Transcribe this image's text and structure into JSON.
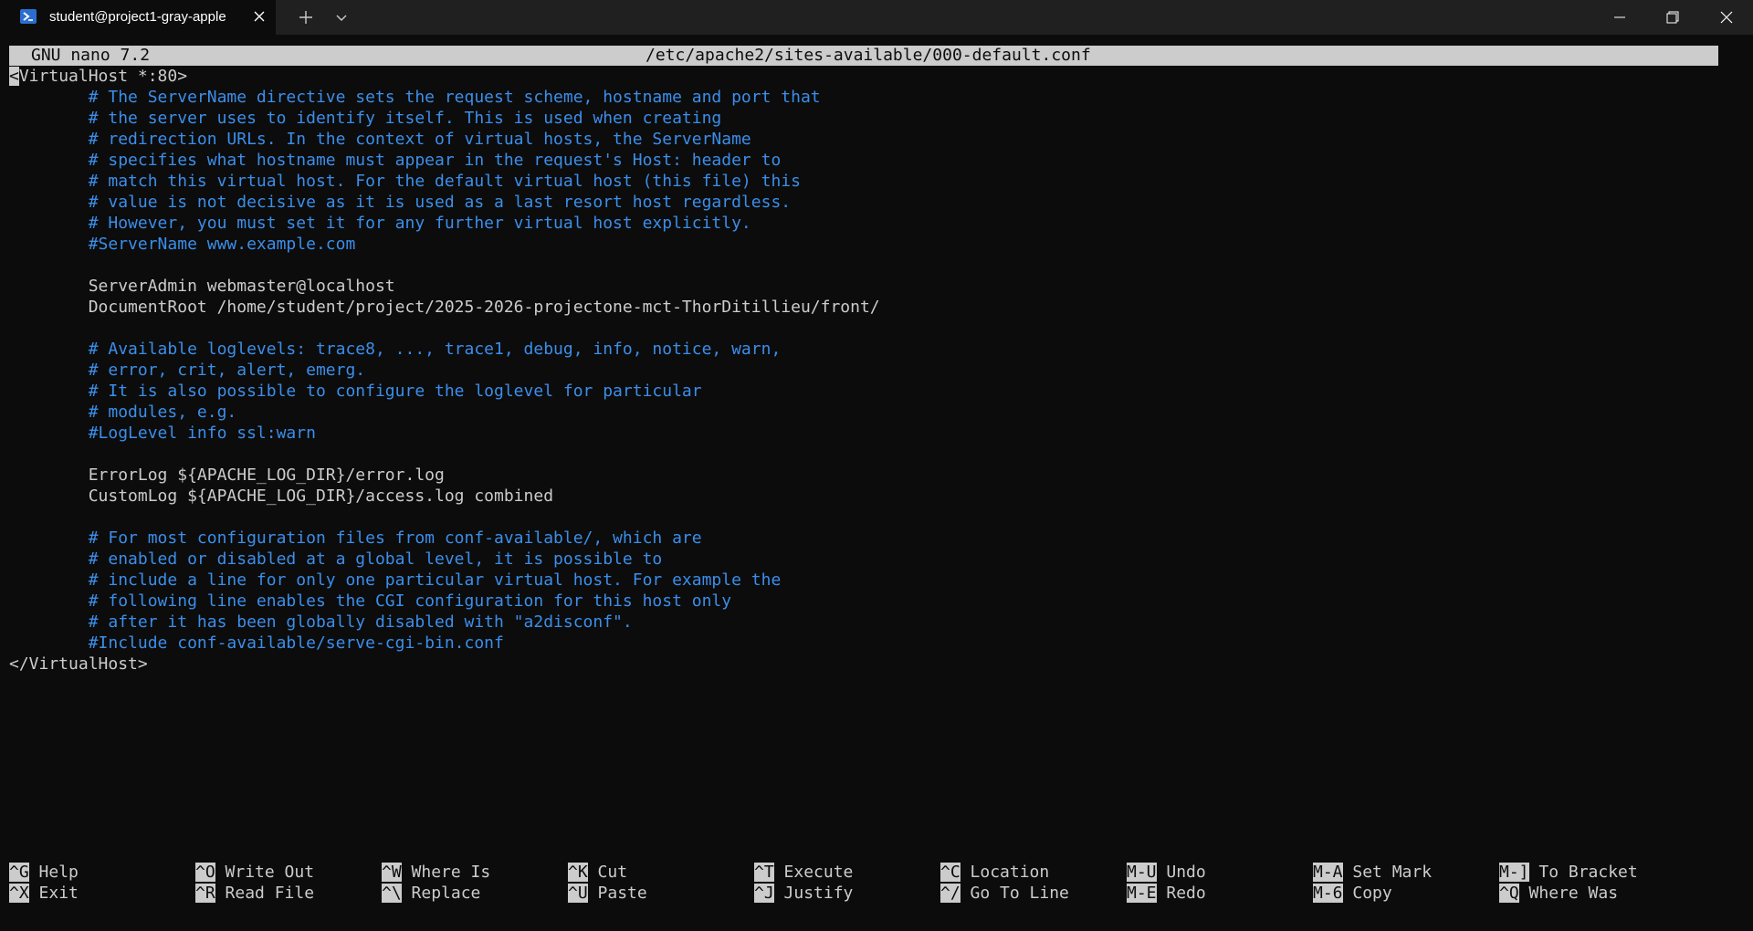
{
  "window": {
    "tab_title": "student@project1-gray-apple"
  },
  "nano": {
    "version": "GNU nano 7.2",
    "filename": "/etc/apache2/sites-available/000-default.conf"
  },
  "lines": [
    {
      "type": "cursor-tag",
      "text": "<VirtualHost *:80>"
    },
    {
      "type": "comment",
      "text": "        # The ServerName directive sets the request scheme, hostname and port that"
    },
    {
      "type": "comment",
      "text": "        # the server uses to identify itself. This is used when creating"
    },
    {
      "type": "comment",
      "text": "        # redirection URLs. In the context of virtual hosts, the ServerName"
    },
    {
      "type": "comment",
      "text": "        # specifies what hostname must appear in the request's Host: header to"
    },
    {
      "type": "comment",
      "text": "        # match this virtual host. For the default virtual host (this file) this"
    },
    {
      "type": "comment",
      "text": "        # value is not decisive as it is used as a last resort host regardless."
    },
    {
      "type": "comment",
      "text": "        # However, you must set it for any further virtual host explicitly."
    },
    {
      "type": "comment",
      "text": "        #ServerName www.example.com"
    },
    {
      "type": "plain",
      "text": ""
    },
    {
      "type": "plain",
      "text": "        ServerAdmin webmaster@localhost"
    },
    {
      "type": "plain",
      "text": "        DocumentRoot /home/student/project/2025-2026-projectone-mct-ThorDitillieu/front/"
    },
    {
      "type": "plain",
      "text": ""
    },
    {
      "type": "comment",
      "text": "        # Available loglevels: trace8, ..., trace1, debug, info, notice, warn,"
    },
    {
      "type": "comment",
      "text": "        # error, crit, alert, emerg."
    },
    {
      "type": "comment",
      "text": "        # It is also possible to configure the loglevel for particular"
    },
    {
      "type": "comment",
      "text": "        # modules, e.g."
    },
    {
      "type": "comment",
      "text": "        #LogLevel info ssl:warn"
    },
    {
      "type": "plain",
      "text": ""
    },
    {
      "type": "plain",
      "text": "        ErrorLog ${APACHE_LOG_DIR}/error.log"
    },
    {
      "type": "plain",
      "text": "        CustomLog ${APACHE_LOG_DIR}/access.log combined"
    },
    {
      "type": "plain",
      "text": ""
    },
    {
      "type": "comment",
      "text": "        # For most configuration files from conf-available/, which are"
    },
    {
      "type": "comment",
      "text": "        # enabled or disabled at a global level, it is possible to"
    },
    {
      "type": "comment",
      "text": "        # include a line for only one particular virtual host. For example the"
    },
    {
      "type": "comment",
      "text": "        # following line enables the CGI configuration for this host only"
    },
    {
      "type": "comment",
      "text": "        # after it has been globally disabled with \"a2disconf\"."
    },
    {
      "type": "comment",
      "text": "        #Include conf-available/serve-cgi-bin.conf"
    },
    {
      "type": "plain",
      "text": "</VirtualHost>"
    }
  ],
  "shortcuts": [
    {
      "key": "^G",
      "label": "Help"
    },
    {
      "key": "^X",
      "label": "Exit"
    },
    {
      "key": "^O",
      "label": "Write Out"
    },
    {
      "key": "^R",
      "label": "Read File"
    },
    {
      "key": "^W",
      "label": "Where Is"
    },
    {
      "key": "^\\",
      "label": "Replace"
    },
    {
      "key": "^K",
      "label": "Cut"
    },
    {
      "key": "^U",
      "label": "Paste"
    },
    {
      "key": "^T",
      "label": "Execute"
    },
    {
      "key": "^J",
      "label": "Justify"
    },
    {
      "key": "^C",
      "label": "Location"
    },
    {
      "key": "^/",
      "label": "Go To Line"
    },
    {
      "key": "M-U",
      "label": "Undo"
    },
    {
      "key": "M-E",
      "label": "Redo"
    },
    {
      "key": "M-A",
      "label": "Set Mark"
    },
    {
      "key": "M-6",
      "label": "Copy"
    },
    {
      "key": "M-]",
      "label": "To Bracket"
    },
    {
      "key": "^Q",
      "label": "Where Was"
    }
  ],
  "colors": {
    "background": "#0c0c0c",
    "text": "#cccccc",
    "comment": "#3b8eea",
    "titlebar": "#202020"
  }
}
